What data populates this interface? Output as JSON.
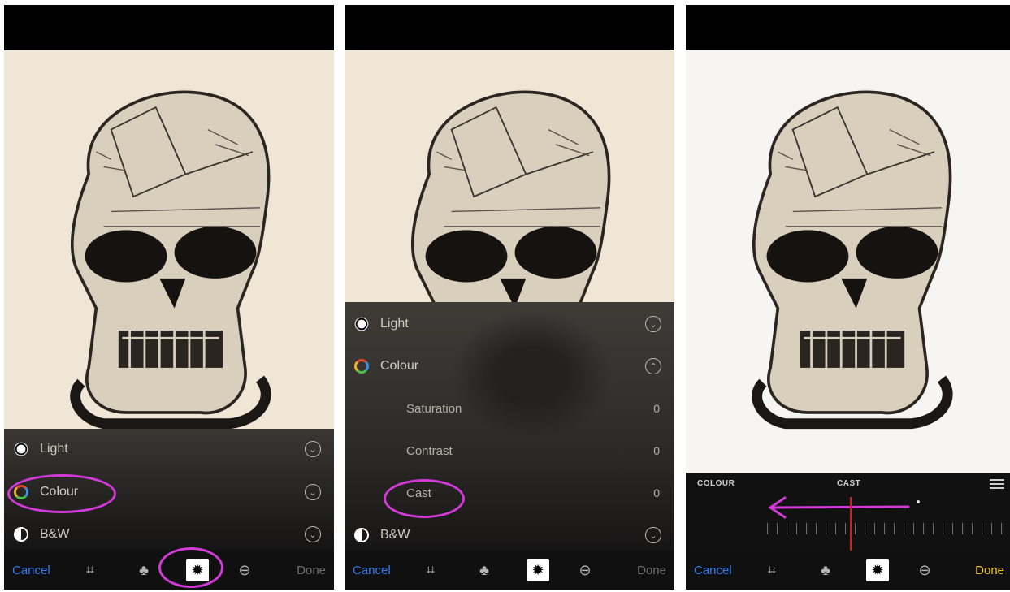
{
  "panels": [
    {
      "menu": [
        {
          "label": "Light",
          "icon": "sun-icon"
        },
        {
          "label": "Colour",
          "icon": "colour-wheel-icon"
        },
        {
          "label": "B&W",
          "icon": "half-circle-icon"
        }
      ],
      "toolbar": {
        "cancel": "Cancel",
        "done": "Done"
      }
    },
    {
      "menu": [
        {
          "label": "Light",
          "icon": "sun-icon"
        },
        {
          "label": "Colour",
          "icon": "colour-wheel-icon"
        },
        {
          "label": "Saturation",
          "value": "0"
        },
        {
          "label": "Contrast",
          "value": "0"
        },
        {
          "label": "Cast",
          "value": "0"
        },
        {
          "label": "B&W",
          "icon": "half-circle-icon"
        }
      ],
      "toolbar": {
        "cancel": "Cancel",
        "done": "Done"
      }
    },
    {
      "adjust": {
        "category": "COLOUR",
        "parameter": "CAST"
      },
      "toolbar": {
        "cancel": "Cancel",
        "done": "Done"
      }
    }
  ],
  "colors": {
    "accent_blue": "#2f7cf6",
    "done_yellow": "#f0c419",
    "annotation": "#d23ad8"
  }
}
